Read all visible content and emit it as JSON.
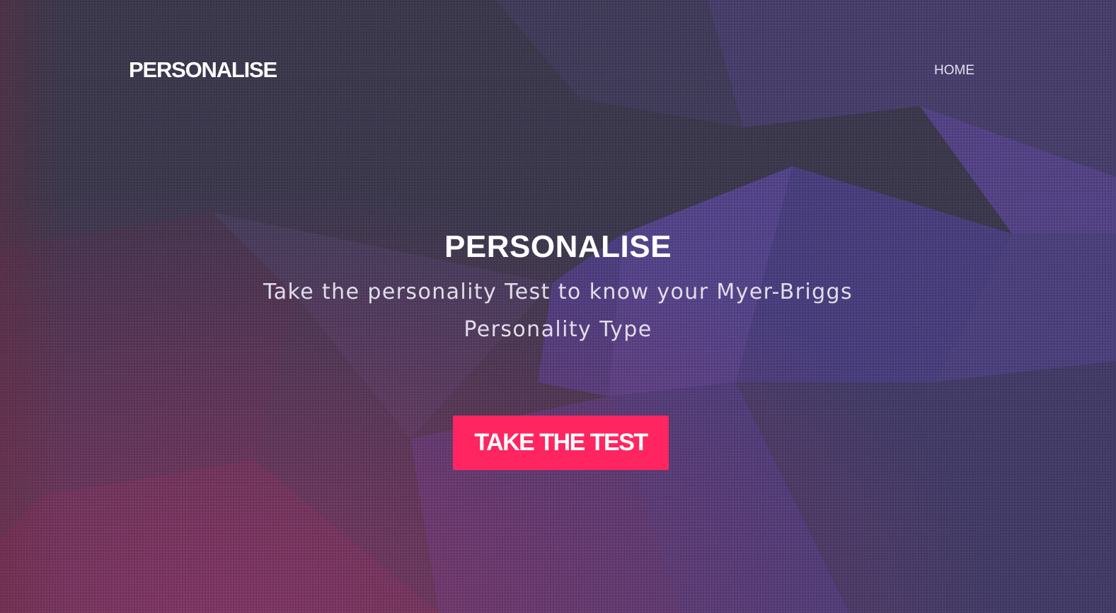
{
  "header": {
    "brand": "PERSONALISE",
    "nav": {
      "home_label": "HOME"
    }
  },
  "hero": {
    "title": "PERSONALISE",
    "subtitle": "Take the personality Test to know your Myer-Briggs Personality Type",
    "cta_label": "TAKE THE TEST"
  },
  "colors": {
    "background": "#3c3a4e",
    "accent_button": "#ff2560",
    "polygon_purple": "#4f4484",
    "polygon_magenta": "#7a3a66",
    "text": "#ffffff"
  }
}
